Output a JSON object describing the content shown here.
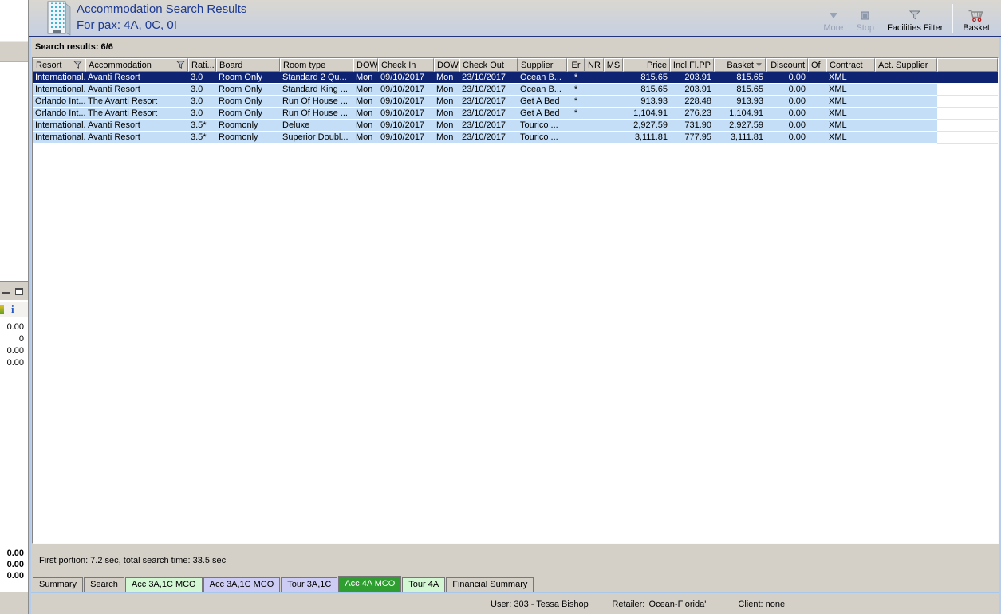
{
  "header": {
    "title": "Accommodation Search Results",
    "subtitle": "For pax: 4A, 0C, 0I",
    "toolbar": [
      {
        "label": "More",
        "icon": "more-chevron-icon",
        "disabled": true
      },
      {
        "label": "Stop",
        "icon": "stop-icon",
        "disabled": true
      },
      {
        "label": "Facilities Filter",
        "icon": "funnel-icon",
        "disabled": false
      },
      {
        "label": "Basket",
        "icon": "basket-cart-icon",
        "disabled": false,
        "separator_before": true
      }
    ]
  },
  "results_bar": {
    "label": "Search results: 6/6"
  },
  "table": {
    "columns": [
      {
        "label": "Resort",
        "width": 66,
        "align": "left",
        "filter_icon": "funnel-icon"
      },
      {
        "label": "Accommodation",
        "width": 129,
        "align": "left",
        "filter_icon": "funnel-icon"
      },
      {
        "label": "Rati...",
        "width": 35,
        "align": "left"
      },
      {
        "label": "Board",
        "width": 80,
        "align": "left"
      },
      {
        "label": "Room type",
        "width": 92,
        "align": "left"
      },
      {
        "label": "DOW",
        "width": 31,
        "align": "left"
      },
      {
        "label": "Check In",
        "width": 70,
        "align": "left"
      },
      {
        "label": "DOW",
        "width": 32,
        "align": "left"
      },
      {
        "label": "Check Out",
        "width": 73,
        "align": "left"
      },
      {
        "label": "Supplier",
        "width": 62,
        "align": "left"
      },
      {
        "label": "Er",
        "width": 22,
        "align": "center"
      },
      {
        "label": "NR",
        "width": 24,
        "align": "center"
      },
      {
        "label": "MS",
        "width": 24,
        "align": "center"
      },
      {
        "label": "Price",
        "width": 59,
        "align": "right"
      },
      {
        "label": "Incl.Fl.PP",
        "width": 55,
        "align": "right"
      },
      {
        "label": "Basket",
        "width": 65,
        "align": "right",
        "sort_icon": "sort-desc-icon"
      },
      {
        "label": "Discount",
        "width": 53,
        "align": "right"
      },
      {
        "label": "Of",
        "width": 23,
        "align": "left"
      },
      {
        "label": "Contract",
        "width": 61,
        "align": "left"
      },
      {
        "label": "Act. Supplier",
        "width": 78,
        "align": "left"
      },
      {
        "label": "",
        "width": 77,
        "align": "left",
        "filler": true
      }
    ],
    "selected_row": 0,
    "rows": [
      [
        "International...",
        "Avanti Resort",
        "3.0",
        "Room Only",
        "Standard 2 Qu...",
        "Mon",
        "09/10/2017",
        "Mon",
        "23/10/2017",
        "Ocean B...",
        "*",
        "",
        "",
        "815.65",
        "203.91",
        "815.65",
        "0.00",
        "",
        "XML",
        "",
        ""
      ],
      [
        "International...",
        "Avanti Resort",
        "3.0",
        "Room Only",
        "Standard King ...",
        "Mon",
        "09/10/2017",
        "Mon",
        "23/10/2017",
        "Ocean B...",
        "*",
        "",
        "",
        "815.65",
        "203.91",
        "815.65",
        "0.00",
        "",
        "XML",
        "",
        ""
      ],
      [
        "Orlando Int...",
        "The Avanti Resort",
        "3.0",
        "Room Only",
        "Run Of House ...",
        "Mon",
        "09/10/2017",
        "Mon",
        "23/10/2017",
        "Get A Bed",
        "*",
        "",
        "",
        "913.93",
        "228.48",
        "913.93",
        "0.00",
        "",
        "XML",
        "",
        ""
      ],
      [
        "Orlando Int...",
        "The Avanti Resort",
        "3.0",
        "Room Only",
        "Run Of House ...",
        "Mon",
        "09/10/2017",
        "Mon",
        "23/10/2017",
        "Get A Bed",
        "*",
        "",
        "",
        "1,104.91",
        "276.23",
        "1,104.91",
        "0.00",
        "",
        "XML",
        "",
        ""
      ],
      [
        "International...",
        "Avanti Resort",
        "3.5*",
        "Roomonly",
        "Deluxe",
        "Mon",
        "09/10/2017",
        "Mon",
        "23/10/2017",
        "Tourico ...",
        "",
        "",
        "",
        "2,927.59",
        "731.90",
        "2,927.59",
        "0.00",
        "",
        "XML",
        "",
        ""
      ],
      [
        "International...",
        "Avanti Resort",
        "3.5*",
        "Roomonly",
        "Superior Doubl...",
        "Mon",
        "09/10/2017",
        "Mon",
        "23/10/2017",
        "Tourico ...",
        "",
        "",
        "",
        "3,111.81",
        "777.95",
        "3,111.81",
        "0.00",
        "",
        "XML",
        "",
        ""
      ]
    ]
  },
  "status_panel": {
    "text": "First portion: 7.2 sec, total search time: 33.5 sec"
  },
  "tabs": [
    {
      "label": "Summary",
      "color": "gray"
    },
    {
      "label": "Search",
      "color": "gray"
    },
    {
      "label": "Acc 3A,1C MCO",
      "color": "green-light"
    },
    {
      "label": "Acc 3A,1C MCO",
      "color": "lavender"
    },
    {
      "label": "Tour 3A,1C",
      "color": "lavender"
    },
    {
      "label": "Acc 4A MCO",
      "color": "green-active",
      "active": true
    },
    {
      "label": "Tour 4A",
      "color": "green-light"
    },
    {
      "label": "Financial Summary",
      "color": "gray"
    }
  ],
  "bottom_bar": {
    "segments": [
      "User: 303 - Tessa Bishop",
      "Retailer: 'Ocean-Florida'",
      "Client: none"
    ]
  },
  "left_panel": {
    "upper_values": [
      "0.00",
      "0",
      "0.00",
      "0.00"
    ],
    "lower_values": [
      "0.00",
      "0.00",
      "0.00"
    ],
    "info_icon_glyph": "i"
  },
  "colors": {
    "selection_navy": "#0e2472",
    "row_blue": "#c3def6",
    "title_navy": "#1d3a93",
    "chrome_gray": "#d4d0c8",
    "tab_active_green": "#2f9e31",
    "tab_light_green": "#d3f6d3",
    "tab_lavender": "#ccccf4",
    "blue_edge": "#b5cdeb"
  }
}
